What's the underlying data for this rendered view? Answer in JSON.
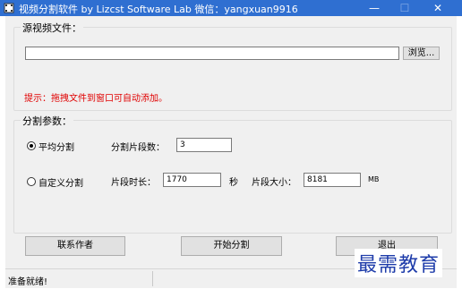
{
  "window": {
    "title": "视频分割软件  by Lizcst Software Lab  微信：yangxuan9916",
    "minimize": "—",
    "maximize": "☐",
    "close": "✕"
  },
  "source": {
    "group_label": "源视频文件：",
    "file_path": "",
    "browse_label": "浏览..."
  },
  "hint": "提示：拖拽文件到窗口可自动添加。",
  "split": {
    "group_label": "分割参数：",
    "mode_average": "平均分割",
    "mode_average_selected": true,
    "segments_label": "分割片段数：",
    "segments_value": "3",
    "mode_custom": "自定义分割",
    "mode_custom_selected": false,
    "duration_label": "片段时长：",
    "duration_value": "1770",
    "duration_unit": "秒",
    "size_label": "片段大小：",
    "size_value": "8181",
    "size_unit": "MB"
  },
  "buttons": {
    "contact": "联系作者",
    "start": "开始分割",
    "exit": "退出"
  },
  "status": {
    "text": "准备就绪!"
  },
  "watermark": "最需教育"
}
